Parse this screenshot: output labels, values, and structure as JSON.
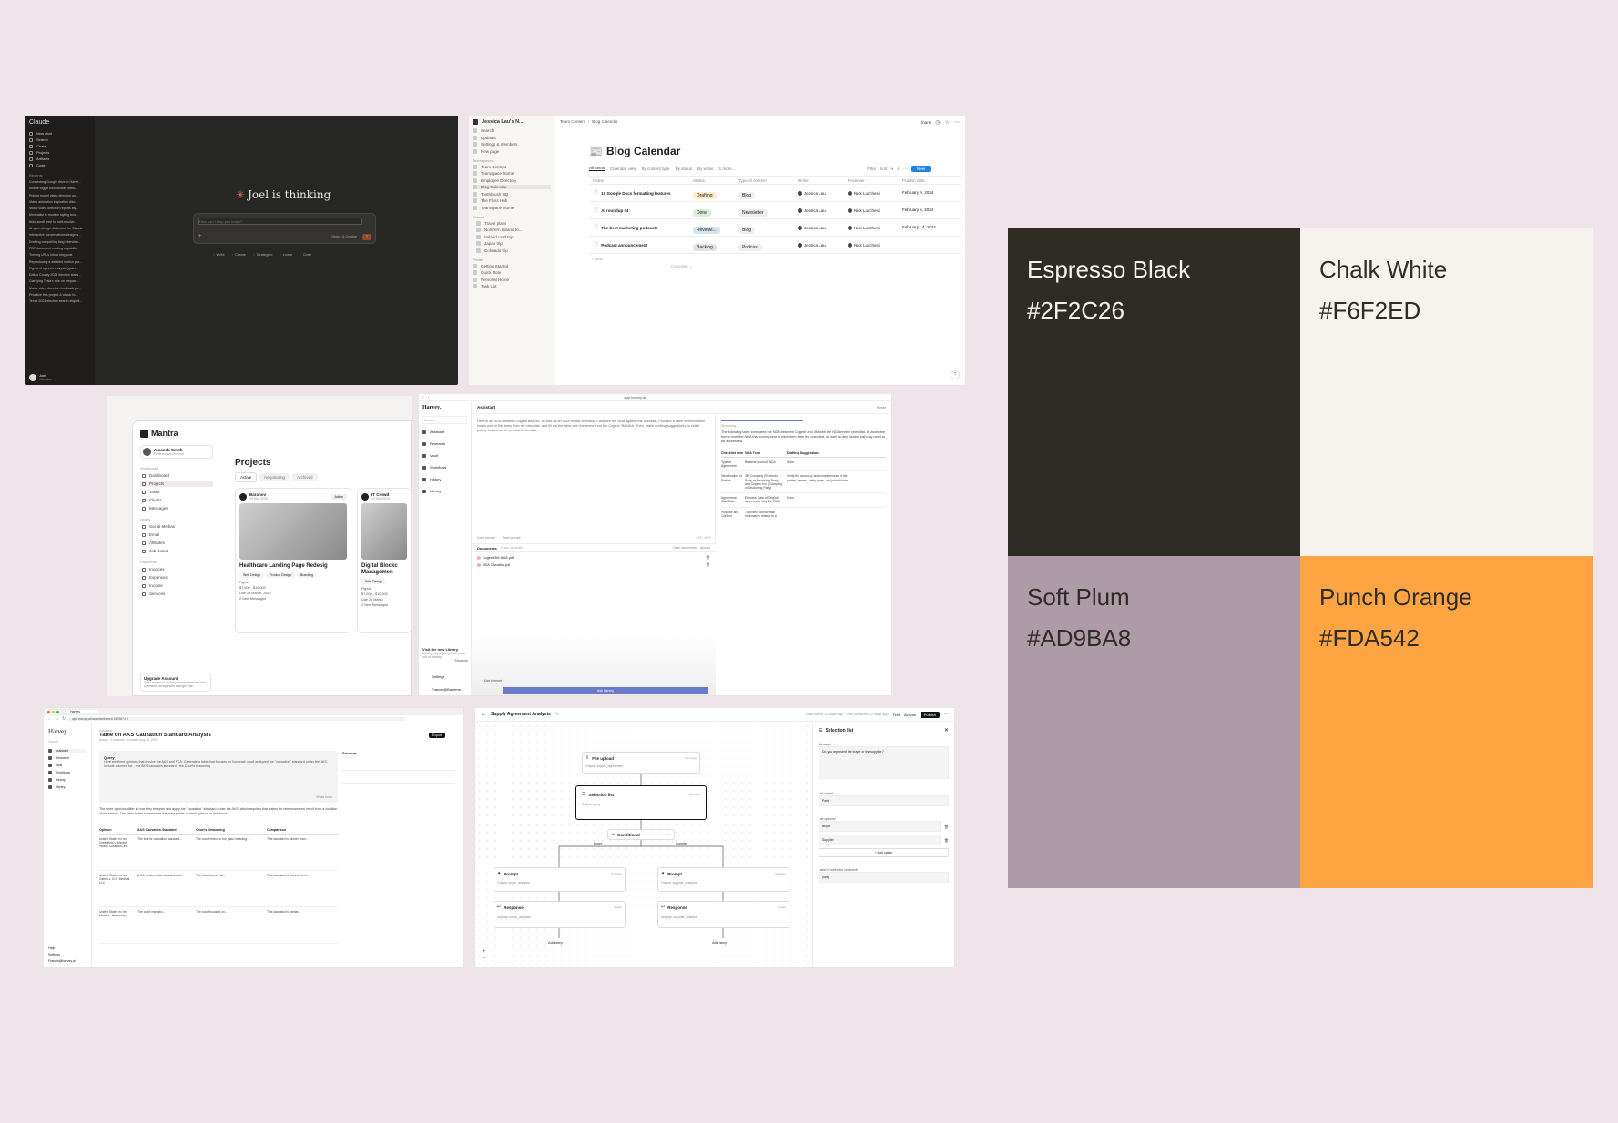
{
  "swatches": [
    {
      "name": "Espresso Black",
      "hex": "#2F2C26",
      "text_color": "#F6F2ED"
    },
    {
      "name": "Chalk White",
      "hex": "#F6F2ED",
      "text_color": "#2F2C26"
    },
    {
      "name": "Soft Plum",
      "hex": "#AD9BA8",
      "text_color": "#2F2C26"
    },
    {
      "name": "Punch Orange",
      "hex": "#FDA542",
      "text_color": "#2F2C26"
    }
  ],
  "claude": {
    "brand": "Claude",
    "nav": [
      "New chat",
      "Search",
      "Chats",
      "Projects",
      "Artifacts",
      "Code"
    ],
    "recents_label": "Recents",
    "recents": [
      "Connecting Google drive to Harve...",
      "Mobile toggle functionality debu...",
      "Pricing model video direction an...",
      "Video animation inspiration disc...",
      "Music video direction reports sty...",
      "Minimalist ty modern styling boo...",
      "Auto-scroll feed for self-resolve...",
      "AI open design distinction for Claude",
      "Interactive conversations design s...",
      "Drafting compelling blog interview...",
      "PDF document reading capability",
      "Turning URLs into a blog post",
      "Reproducing a detailed motion gra...",
      "Figma of speech analysis (quiz f...",
      "Dallas County 2024 election statis...",
      "Clarifying Tesla's role on prepare...",
      "Music video direction feedback po...",
      "Prioritize this project & attack to...",
      "Texas 2024 election search eligibili..."
    ],
    "heading": "Joel is thinking",
    "input_placeholder": "How can I help you today?",
    "model": "Opus 4.6 Concise",
    "chips": [
      "Write",
      "Create",
      "Strategize",
      "Learn",
      "Code"
    ],
    "user": "Joel",
    "plan": "Max plan"
  },
  "notion": {
    "workspace": "Jessica Lau's N...",
    "nav": [
      "Search",
      "Updates",
      "Settings & members",
      "New page"
    ],
    "teamspaces_label": "Teamspaces",
    "teamspaces": [
      "Team Content",
      "Teamspace Home",
      "Employee Directory",
      "Blog Calendar",
      "Toothbrush HQ",
      "The Floss Hub",
      "Teamspace Home"
    ],
    "shared_label": "Shared",
    "shared": [
      "Travel plans",
      "Northern Ireland ro...",
      "Ireland road trip",
      "Japan trip",
      "Colorado trip"
    ],
    "private_label": "Private",
    "private": [
      "Getting Started",
      "Quick Note",
      "Personal Home",
      "Task List"
    ],
    "breadcrumb": [
      "Team Content",
      "Blog Calendar"
    ],
    "share": "Share",
    "title": "Blog Calendar",
    "views": [
      "All items",
      "Calendar view",
      "By content type",
      "By status",
      "By writer",
      "1 more..."
    ],
    "toolbar": [
      "Filter",
      "Sort",
      "New"
    ],
    "columns": [
      "Name",
      "Status",
      "Type of content",
      "Writer",
      "Reviewer",
      "Publish date"
    ],
    "rows": [
      {
        "name": "10 Google Docs formatting features",
        "status": "Drafting",
        "type": "Blog",
        "writer": "Jessica Lau",
        "reviewer": "Nick Lucchesi",
        "date": "February 9, 2024"
      },
      {
        "name": "AI roundup #4",
        "status": "Done",
        "type": "Newsletter",
        "writer": "Jessica Lau",
        "reviewer": "Nick Lucchesi",
        "date": "February 6, 2024"
      },
      {
        "name": "The best marketing podcasts",
        "status": "Reviewi...",
        "type": "Blog",
        "writer": "Jessica Lau",
        "reviewer": "Nick Lucchesi",
        "date": "February 14, 2024"
      },
      {
        "name": "Podcast announcement",
        "status": "Backlog",
        "type": "Podcast",
        "writer": "Jessica Lau",
        "reviewer": "Nick Lucchesi",
        "date": ""
      }
    ],
    "new_row": "+ New",
    "calculate": "Calculate ⌄"
  },
  "mantra": {
    "brand": "Mantra",
    "user": "Amanda Smith",
    "account": "Professional Account",
    "workspace_label": "Workspace",
    "workspace": [
      "Dashboard",
      "Projects",
      "Tasks",
      "Clients",
      "Messages"
    ],
    "leads_label": "Leads",
    "leads": [
      "Social Medias",
      "Email",
      "Affiliates",
      "Job Board"
    ],
    "payments_label": "Payments",
    "payments": [
      "Invoices",
      "Expenses",
      "Income",
      "Services"
    ],
    "upgrade_title": "Upgrade Account",
    "upgrade_text": "Gain access to all the powerful features and unlimited storage with a single plan",
    "title": "Projects",
    "tabs": [
      "Active",
      "Negotiating",
      "Archived"
    ],
    "cards": [
      {
        "client": "Baranov",
        "date": "09 Mar 2025",
        "status": "Active",
        "title": "Healthcare Landing Page Redesig",
        "tags": [
          "Web Design",
          "Product Design",
          "Branding"
        ],
        "tool": "Figma",
        "budget": "$7,000 - $10,000",
        "due": "Due 29 March, 2025",
        "messages": "2 New Messages"
      },
      {
        "client": "IT Crowd",
        "date": "09 Mar 2025",
        "status": "",
        "title": "Digital Blockc Managemen",
        "tags": [
          "Web Design"
        ],
        "tool": "Figma",
        "budget": "$7,000 - $10,000",
        "due": "Due 29 March",
        "messages": "2 New Messages"
      }
    ]
  },
  "harvey1": {
    "url": "app.harvey.ai",
    "brand": "Harvey.",
    "search": "Search",
    "nav": [
      "Assistant",
      "Research",
      "Vault",
      "Workflows",
      "History",
      "Library"
    ],
    "library_promo": "Visit the new Library",
    "library_text": "Library helps you get the most out of Harvey",
    "show_me": "Show me",
    "settings": "Settings",
    "user": "Francis@Baseme...",
    "header": "Assistant",
    "reset": "Reset",
    "prompt": "Here is an NDA between Cogent and 3M, as well as an NDA review checklist. Compare the NDA against the checklist. Produce a table in which each row is one of the items from the checklist, and fill out the table with the terms from the Cogent 3M NDA. Then, make drafting suggestions, in bullet points, based on the provided checklist.",
    "load_prompt": "Load prompt",
    "save_prompt": "Save prompt",
    "counter": "303 / 4000",
    "documents_label": "Documents",
    "documents_count": "2 files uploaded",
    "clear_docs": "Clear documents",
    "upload": "Upload",
    "docs": [
      "Cogent-3M NDA.pdf",
      "NDA Checklist.pdf"
    ],
    "use_internet": "Use Internet",
    "ask": "Ask Harvey",
    "streaming": "Streaming...",
    "answer": "The following table compares the NDA between Cogent and 3M with the NDA review checklist. It shows the terms from the NDA that correspond to each item from the checklist, as well as any issues that may need to be addressed.",
    "table_headers": [
      "Checklist Item",
      "NDA Term",
      "Drafting Suggestions"
    ],
    "table_rows": [
      [
        "Type of Agreement",
        "Bilateral (mutual) NDA",
        "None"
      ],
      [
        "Identification of Parties",
        "3M Company (Receiving Party or Receiving Party) and Cogent, Inc. (Company or Disclosing Party)",
        "Verify the accuracy and completeness of the parties' names, entity types, and jurisdictions"
      ],
      [
        "Agreement Start Date",
        "Effective Date of Original Agreement: July 31, 2006",
        "None"
      ],
      [
        "Purpose and Context",
        "To protect confidential information related to a",
        ""
      ]
    ]
  },
  "harvey2": {
    "tab": "Harvey",
    "url": "app.harvey.ai/assistant/ceed/1629674 3",
    "brand": "Harvey",
    "search": "Search",
    "nav": [
      "Assistant",
      "Research",
      "Vault",
      "Workflows",
      "History",
      "Library"
    ],
    "footer": [
      "Help",
      "Settings",
      "Francis@harvey.ai"
    ],
    "breadcrumb": "Assistant",
    "title": "Table on AKS Causation Standard Analysis",
    "meta": "Assist · 2 sources · Created Aug 15, 2024",
    "export": "Export",
    "query_label": "Query",
    "query": "Here are three opinions that involve the AKS and FCA. Generate a table that focuses on how each court analyzed the \"causation\" standard under the AKS. Include columns for: - the AKS causation standard - the Court's reasoning",
    "show_more": "Show more",
    "sources_label": "Sources",
    "answer_intro": "The three opinions differ in how they interpret and apply the \"causation\" standard under the AKS, which requires that claims for reimbursement result from a violation of the statute. The table below summarizes the main points of each opinion on this issue:",
    "table_headers": [
      "Opinion",
      "AKS Causation Standard",
      "Court's Reasoning",
      "Comparison"
    ],
    "table_rows": [
      [
        "United States ex rel. Greenfield v. Medco Health Solutions, Inc.",
        "The but-for causation standard...",
        "The court relied on the plain meaning...",
        "This standard is stricter than..."
      ],
      [
        "United States ex rel. Cairns v. D.S. Medical LLC",
        "A link between the kickback and...",
        "The court found that...",
        "This standard is more lenient..."
      ],
      [
        "United States ex rel. Martin v. Hathaway",
        "The court rejected...",
        "The court focused on...",
        "This standard is similar..."
      ]
    ]
  },
  "workflow": {
    "back": "Supply Agreement Analysis",
    "status": "Draft saved 12 days ago · Last published 12 days ago",
    "test": "Test",
    "access": "Access",
    "publish": "Publish",
    "nodes": {
      "file_upload": {
        "title": "File upload",
        "tag": "New input",
        "output": "supply_agreement"
      },
      "selection_list": {
        "title": "Selection list",
        "tag": "New input",
        "output": "party"
      },
      "conditional": {
        "title": "Conditional",
        "tag": "Logic"
      },
      "branch_left": "Buyer",
      "branch_right": "Supplier",
      "prompt_left": {
        "title": "Prompt",
        "tag": "AI Action",
        "output": "buyer_analysis"
      },
      "prompt_right": {
        "title": "Prompt",
        "tag": "AI Action",
        "output": "supplier_analysis"
      },
      "response_left": {
        "title": "Response",
        "tag": "Output",
        "display": "buyer_analysis"
      },
      "response_right": {
        "title": "Response",
        "tag": "Output",
        "display": "supplier_analysis"
      },
      "add_step": "Add step"
    },
    "panel": {
      "title": "Selection list",
      "message_label": "Message*",
      "message": "Do you represent the buyer or the supplier?",
      "list_name_label": "List name*",
      "list_name": "Party",
      "list_options_label": "List options*",
      "options": [
        "Buyer",
        "Supplier"
      ],
      "add_option": "+ Add option",
      "label_label": "Label of selection collected*",
      "label": "party"
    }
  }
}
